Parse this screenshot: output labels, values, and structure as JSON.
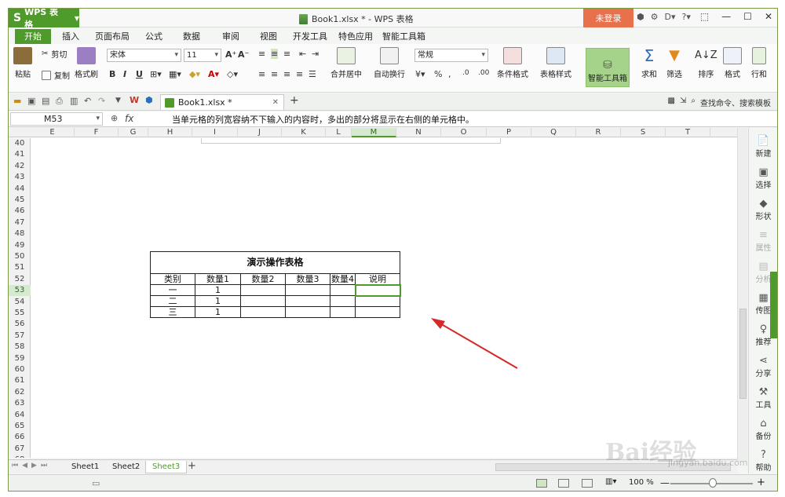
{
  "app": {
    "name": "WPS 表格",
    "window_title": "Book1.xlsx * - WPS 表格",
    "login": "未登录",
    "accent": "#4e9a2a"
  },
  "title_icons": [
    "⬢",
    "⚙",
    "D▾",
    "?▾"
  ],
  "ribbon_tabs": [
    "开始",
    "插入",
    "页面布局",
    "公式",
    "数据",
    "审阅",
    "视图",
    "开发工具",
    "特色应用",
    "智能工具箱"
  ],
  "ribbon": {
    "paste": "粘贴",
    "cut": "剪切",
    "copy": "复制",
    "format_painter": "格式刷",
    "font_name": "宋体",
    "font_size": "11",
    "bold": "B",
    "italic": "I",
    "underline": "U",
    "merge_center": "合并居中",
    "wrap_text": "自动换行",
    "number_format": "常规",
    "conditional_format": "条件格式",
    "table_style": "表格样式",
    "smart_tools": "智能工具箱",
    "sum": "求和",
    "filter": "筛选",
    "sort": "排序",
    "format": "格式",
    "rows_cols": "行和"
  },
  "doc_tab": "Book1.xlsx *",
  "search_cmd": "查找命令、搜索模板",
  "formula_bar": {
    "name_box": "M53",
    "fx": "fx",
    "content": "当单元格的列宽容纳不下输入的内容时，多出的部分将显示在右侧的单元格中。"
  },
  "columns": [
    "E",
    "F",
    "G",
    "H",
    "I",
    "J",
    "K",
    "L",
    "M",
    "N",
    "O",
    "P",
    "Q",
    "R",
    "S",
    "T"
  ],
  "rows": [
    "40",
    "41",
    "42",
    "43",
    "44",
    "45",
    "46",
    "47",
    "48",
    "49",
    "50",
    "51",
    "52",
    "53",
    "54",
    "55",
    "56",
    "57",
    "58",
    "59",
    "60",
    "61",
    "62",
    "63",
    "64",
    "65",
    "66",
    "67",
    "68"
  ],
  "selected_cell": {
    "column": "M",
    "row": "53"
  },
  "table": {
    "title": "演示操作表格",
    "headers": [
      "类别",
      "数量1",
      "数量2",
      "数量3",
      "数量4",
      "说明"
    ],
    "rows": [
      [
        "一",
        "1",
        "",
        "",
        "",
        ""
      ],
      [
        "二",
        "1",
        "",
        "",
        "",
        ""
      ],
      [
        "三",
        "1",
        "",
        "",
        "",
        ""
      ]
    ]
  },
  "sidebar": [
    {
      "label": "新建",
      "icon": "📄",
      "enabled": true
    },
    {
      "label": "选择",
      "icon": "▣",
      "enabled": true
    },
    {
      "label": "形状",
      "icon": "◆",
      "enabled": true
    },
    {
      "label": "属性",
      "icon": "≡",
      "enabled": false
    },
    {
      "label": "分析",
      "icon": "▤",
      "enabled": false
    },
    {
      "label": "传图",
      "icon": "▦",
      "enabled": true
    },
    {
      "label": "推荐",
      "icon": "♀",
      "enabled": true
    },
    {
      "label": "分享",
      "icon": "⋖",
      "enabled": true
    },
    {
      "label": "工具",
      "icon": "⚒",
      "enabled": true
    },
    {
      "label": "备份",
      "icon": "⌂",
      "enabled": true
    },
    {
      "label": "帮助",
      "icon": "?",
      "enabled": true
    }
  ],
  "sheets": [
    "Sheet1",
    "Sheet2",
    "Sheet3"
  ],
  "active_sheet": "Sheet3",
  "status": {
    "zoom": "100 %"
  },
  "watermark": {
    "text": "Bai经验",
    "url": "jingyan.baidu.com"
  }
}
